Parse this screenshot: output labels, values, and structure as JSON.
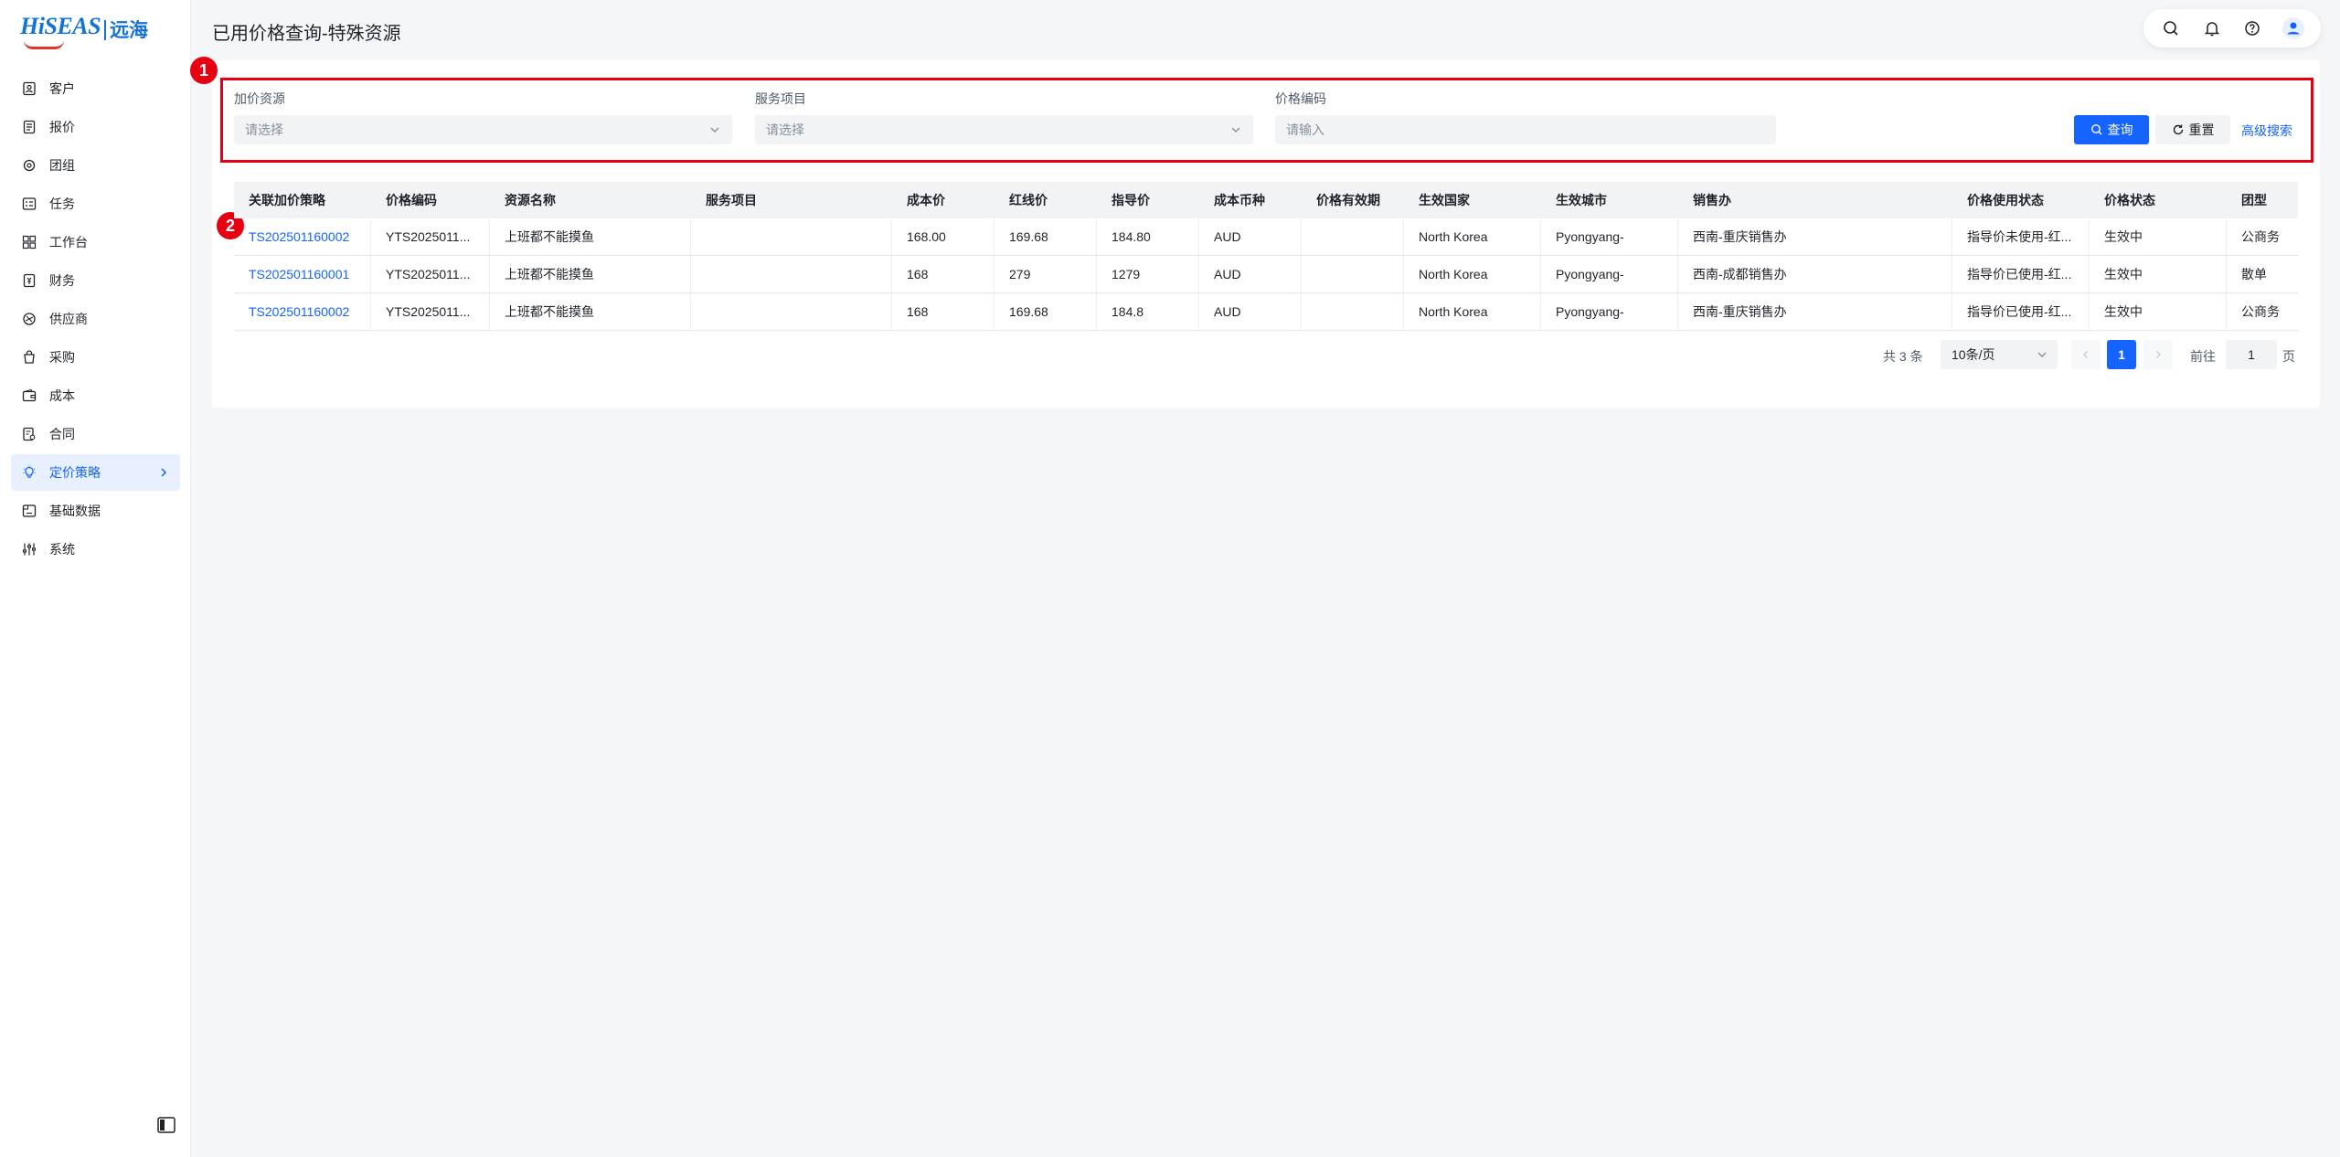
{
  "brand": {
    "name": "HiSEAS",
    "sub": "远海"
  },
  "page": {
    "title": "已用价格查询-特殊资源"
  },
  "sidebar": {
    "items": [
      {
        "label": "客户",
        "icon": "customer-icon"
      },
      {
        "label": "报价",
        "icon": "quote-icon"
      },
      {
        "label": "团组",
        "icon": "group-icon"
      },
      {
        "label": "任务",
        "icon": "task-icon"
      },
      {
        "label": "工作台",
        "icon": "workbench-icon"
      },
      {
        "label": "财务",
        "icon": "finance-icon"
      },
      {
        "label": "供应商",
        "icon": "supplier-icon"
      },
      {
        "label": "采购",
        "icon": "purchase-icon"
      },
      {
        "label": "成本",
        "icon": "cost-icon"
      },
      {
        "label": "合同",
        "icon": "contract-icon"
      },
      {
        "label": "定价策略",
        "icon": "pricing-icon",
        "active": true
      },
      {
        "label": "基础数据",
        "icon": "database-icon"
      },
      {
        "label": "系统",
        "icon": "system-icon"
      }
    ]
  },
  "markers": {
    "one": "1",
    "two": "2"
  },
  "filters": {
    "resource_label": "加价资源",
    "resource_placeholder": "请选择",
    "service_label": "服务项目",
    "service_placeholder": "请选择",
    "code_label": "价格编码",
    "code_placeholder": "请输入",
    "search_label": "查询",
    "reset_label": "重置",
    "advanced_label": "高级搜索"
  },
  "table": {
    "columns": [
      "关联加价策略",
      "价格编码",
      "资源名称",
      "服务项目",
      "成本价",
      "红线价",
      "指导价",
      "成本币种",
      "价格有效期",
      "生效国家",
      "生效城市",
      "销售办",
      "价格使用状态",
      "价格状态",
      "团型"
    ],
    "rows": [
      [
        "TS202501160002",
        "YTS2025011...",
        "上班都不能摸鱼",
        "",
        "168.00",
        "169.68",
        "184.80",
        "AUD",
        "",
        "North Korea",
        "Pyongyang-",
        "西南-重庆销售办",
        "指导价未使用-红...",
        "生效中",
        "公商务"
      ],
      [
        "TS202501160001",
        "YTS2025011...",
        "上班都不能摸鱼",
        "",
        "168",
        "279",
        "1279",
        "AUD",
        "",
        "North Korea",
        "Pyongyang-",
        "西南-成都销售办",
        "指导价已使用-红...",
        "生效中",
        "散单"
      ],
      [
        "TS202501160002",
        "YTS2025011...",
        "上班都不能摸鱼",
        "",
        "168",
        "169.68",
        "184.8",
        "AUD",
        "",
        "North Korea",
        "Pyongyang-",
        "西南-重庆销售办",
        "指导价已使用-红...",
        "生效中",
        "公商务"
      ]
    ]
  },
  "pagination": {
    "total": "共 3 条",
    "page_size": "10条/页",
    "current": "1",
    "goto_label": "前往",
    "goto_value": "1",
    "page_suffix": "页"
  },
  "colors": {
    "primary": "#1664ff",
    "marker": "#e60012",
    "active_bg": "#e8f0ff"
  }
}
